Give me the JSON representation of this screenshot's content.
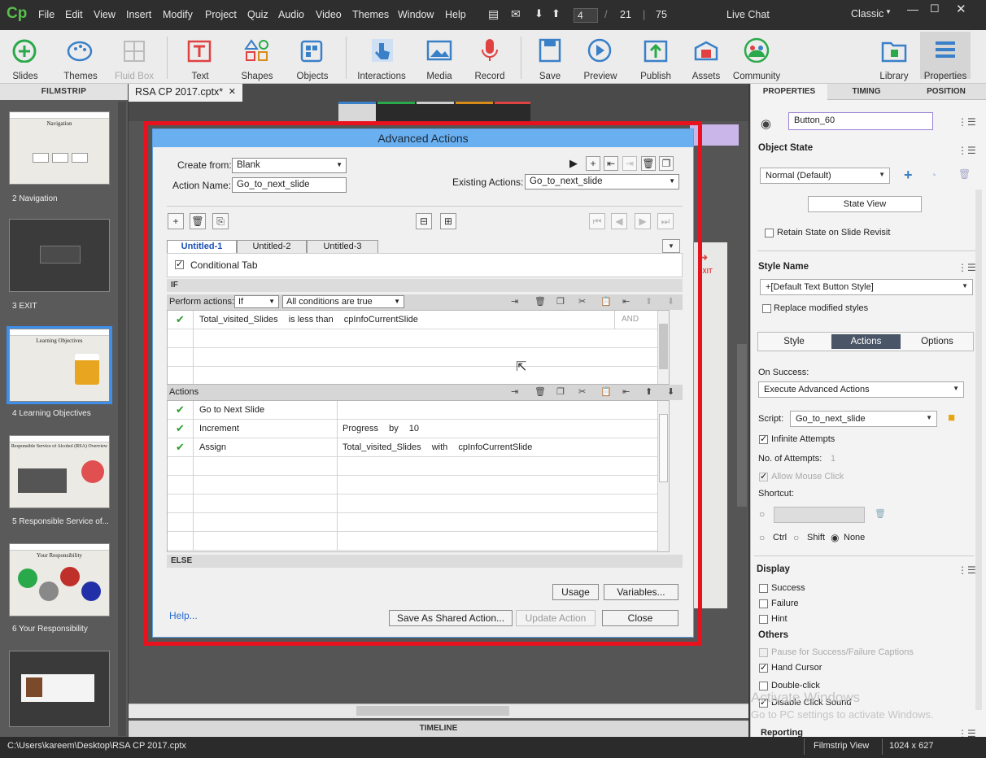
{
  "menubar": {
    "logo": "Cp",
    "items": [
      "File",
      "Edit",
      "View",
      "Insert",
      "Modify",
      "Project",
      "Quiz",
      "Audio",
      "Video",
      "Themes",
      "Window",
      "Help"
    ],
    "page_current": "4",
    "page_total": "21",
    "zoom": "75",
    "live_chat": "Live Chat",
    "workspace": "Classic"
  },
  "toolbar": {
    "slides": "Slides",
    "themes": "Themes",
    "fluidbox": "Fluid Box",
    "text": "Text",
    "shapes": "Shapes",
    "objects": "Objects",
    "interactions": "Interactions",
    "media": "Media",
    "record": "Record",
    "save": "Save",
    "preview": "Preview",
    "publish": "Publish",
    "assets": "Assets",
    "community": "Community",
    "library": "Library",
    "properties": "Properties"
  },
  "filmstrip": {
    "header": "FILMSTRIP",
    "slides": [
      {
        "label": "2 Navigation",
        "title": "Navigation"
      },
      {
        "label": "3 EXIT",
        "title": ""
      },
      {
        "label": "4 Learning Objectives",
        "title": "Learning Objectives"
      },
      {
        "label": "5 Responsible Service of...",
        "title": "Responsible Service of Alcohol (RSA) Overview"
      },
      {
        "label": "6 Your Responsibility",
        "title": "Your Responsibility"
      },
      {
        "label": "",
        "title": ""
      }
    ]
  },
  "doc": {
    "tab": "RSA CP 2017.cptx*",
    "timeline": "TIMELINE",
    "exit": "EXIT"
  },
  "dialog": {
    "title": "Advanced Actions",
    "create_from_label": "Create from:",
    "create_from_value": "Blank",
    "action_name_label": "Action Name:",
    "action_name_value": "Go_to_next_slide",
    "existing_label": "Existing Actions:",
    "existing_value": "Go_to_next_slide",
    "tabs": [
      "Untitled-1",
      "Untitled-2",
      "Untitled-3"
    ],
    "conditional_tab": "Conditional Tab",
    "if_label": "IF",
    "perform_label": "Perform actions:",
    "perform_value": "If",
    "conditions_value": "All conditions are true",
    "condition": {
      "var": "Total_visited_Slides",
      "op": "is less than",
      "val": "cpInfoCurrentSlide",
      "logic": "AND"
    },
    "actions_label": "Actions",
    "actions": [
      {
        "action": "Go to Next Slide",
        "p1": "",
        "p2": "",
        "p3": ""
      },
      {
        "action": "Increment",
        "p1": "Progress",
        "p2": "by",
        "p3": "10"
      },
      {
        "action": "Assign",
        "p1": "Total_visited_Slides",
        "p2": "with",
        "p3": "cpInfoCurrentSlide"
      }
    ],
    "else_label": "ELSE",
    "usage": "Usage",
    "variables": "Variables...",
    "help": "Help...",
    "save_shared": "Save As Shared Action...",
    "update": "Update Action",
    "close": "Close"
  },
  "props": {
    "tabs": [
      "PROPERTIES",
      "TIMING",
      "POSITION"
    ],
    "name": "Button_60",
    "object_state": "Object State",
    "state_value": "Normal (Default)",
    "state_view": "State View",
    "retain_state": "Retain State on Slide Revisit",
    "style_name": "Style Name",
    "style_value": "+[Default Text Button Style]",
    "replace_styles": "Replace modified styles",
    "subtabs": [
      "Style",
      "Actions",
      "Options"
    ],
    "on_success": "On Success:",
    "on_success_value": "Execute Advanced Actions",
    "script_label": "Script:",
    "script_value": "Go_to_next_slide",
    "infinite": "Infinite Attempts",
    "attempts_label": "No. of Attempts:",
    "attempts_value": "1",
    "allow_mouse": "Allow Mouse Click",
    "shortcut": "Shortcut:",
    "ctrl": "Ctrl",
    "shift": "Shift",
    "none": "None",
    "display": "Display",
    "success": "Success",
    "failure": "Failure",
    "hint": "Hint",
    "others": "Others",
    "pause": "Pause for Success/Failure Captions",
    "hand": "Hand Cursor",
    "dblclick": "Double-click",
    "disable_sound": "Disable Click Sound",
    "reporting": "Reporting",
    "watermark1": "Activate Windows",
    "watermark2": "Go to PC settings to activate Windows."
  },
  "status": {
    "path": "C:\\Users\\kareem\\Desktop\\RSA CP 2017.cptx",
    "view": "Filmstrip View",
    "size": "1024 x 627"
  },
  "colors": {
    "highlight_frame": "#e8111d",
    "dialog_title": "#6ab0f1",
    "accent": "#3f8ee9",
    "check": "#2a9d2a"
  }
}
